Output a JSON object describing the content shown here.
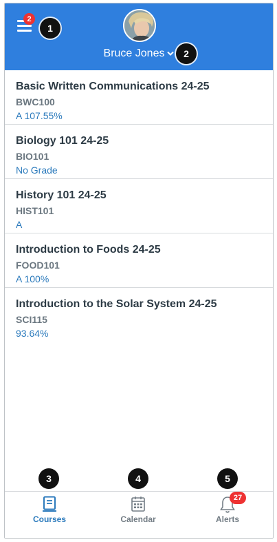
{
  "header": {
    "menu_badge": "2",
    "user_name": "Bruce Jones",
    "bg_color": "#2f7fde"
  },
  "courses": [
    {
      "title": "Basic Written Communications 24-25",
      "code": "BWC100",
      "grade": "A  107.55%"
    },
    {
      "title": "Biology 101 24-25",
      "code": "BIO101",
      "grade": "No Grade"
    },
    {
      "title": "History 101 24-25",
      "code": "HIST101",
      "grade": "A"
    },
    {
      "title": "Introduction to Foods 24-25",
      "code": "FOOD101",
      "grade": "A  100%"
    },
    {
      "title": "Introduction to the Solar System  24-25",
      "code": "SCI115",
      "grade": "93.64%"
    }
  ],
  "tabs": [
    {
      "label": "Courses",
      "icon": "courses-icon",
      "active": true
    },
    {
      "label": "Calendar",
      "icon": "calendar-icon",
      "active": false
    },
    {
      "label": "Alerts",
      "icon": "bell-icon",
      "active": false,
      "badge": "27"
    }
  ],
  "callouts": [
    "1",
    "2",
    "3",
    "4",
    "5"
  ],
  "colors": {
    "accent": "#2b7abc",
    "badge": "#ee3232",
    "text": "#2d3b45"
  }
}
